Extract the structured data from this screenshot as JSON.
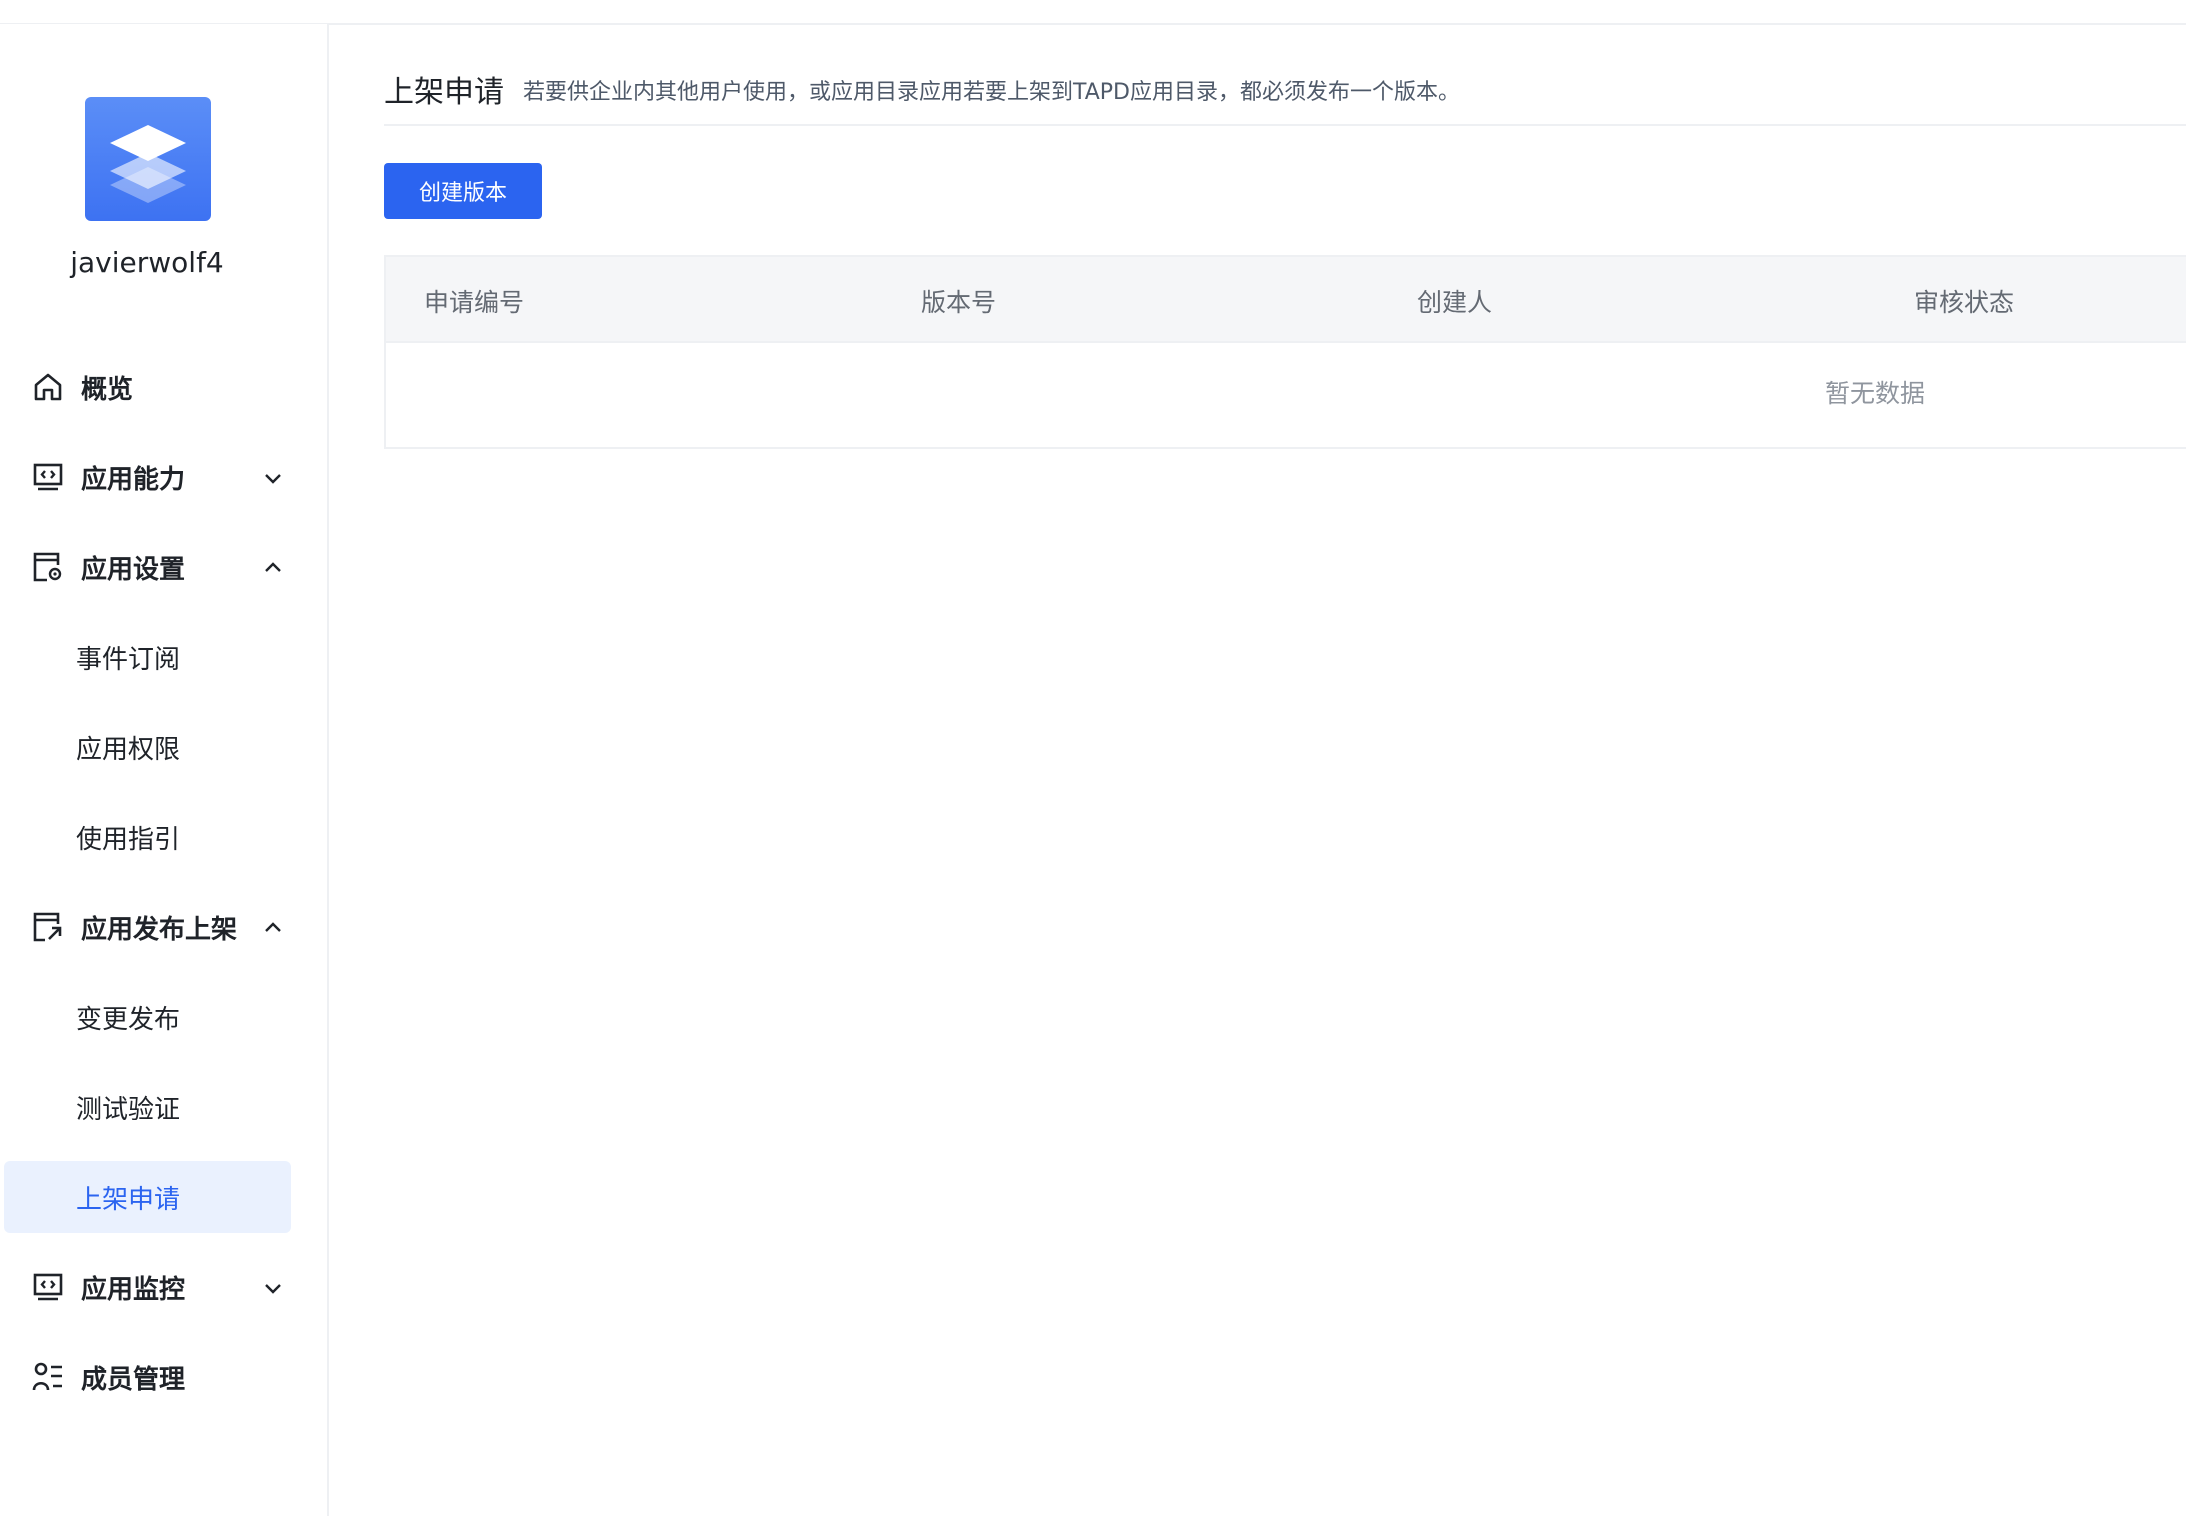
{
  "app": {
    "name": "javierwolf4"
  },
  "sidebar": {
    "items": [
      {
        "label": "概览",
        "icon": "home-icon"
      },
      {
        "label": "应用能力",
        "icon": "monitor-code-icon",
        "expanded": false
      },
      {
        "label": "应用设置",
        "icon": "settings-window-icon",
        "expanded": true,
        "children": [
          "事件订阅",
          "应用权限",
          "使用指引"
        ]
      },
      {
        "label": "应用发布上架",
        "icon": "publish-icon",
        "expanded": true,
        "children": [
          "变更发布",
          "测试验证",
          "上架申请"
        ]
      },
      {
        "label": "应用监控",
        "icon": "monitor-code-icon",
        "expanded": false
      },
      {
        "label": "成员管理",
        "icon": "members-icon"
      }
    ],
    "active_item": "上架申请",
    "active_color": "#2b64f0"
  },
  "main": {
    "title": "上架申请",
    "description": "若要供企业内其他用户使用，或应用目录应用若要上架到TAPD应用目录，都必须发布一个版本。",
    "create_button": "创建版本",
    "table": {
      "columns": [
        "申请编号",
        "版本号",
        "创建人",
        "审核状态"
      ],
      "empty_text": "暂无数据"
    }
  },
  "colors": {
    "primary": "#2b64f0",
    "active_bg": "#eaf1fe",
    "header_bg": "#f5f6f8"
  }
}
